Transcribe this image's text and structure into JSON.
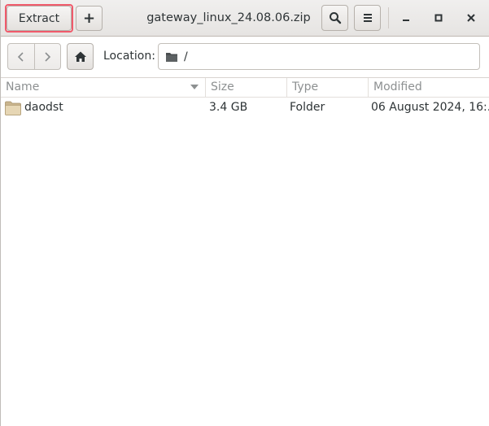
{
  "header": {
    "title": "gateway_linux_24.08.06.zip",
    "extract_label": "Extract",
    "add_label": "+",
    "search_icon": "search-icon",
    "menu_icon": "hamburger-menu-icon",
    "window_controls": [
      "minimize-icon",
      "maximize-icon",
      "close-icon"
    ],
    "highlight_color": "#f05a6b"
  },
  "location_bar": {
    "back_icon": "chevron-left-icon",
    "forward_icon": "chevron-right-icon",
    "home_icon": "home-icon",
    "label": "Location:",
    "folder_icon": "folder-icon",
    "path": "/"
  },
  "list": {
    "columns": [
      "Name",
      "Size",
      "Type",
      "Modified"
    ],
    "sorted_by": "Name",
    "rows": [
      {
        "icon": "folder-icon",
        "name": "daodst",
        "size": "3.4 GB",
        "type": "Folder",
        "modified": "06 August 2024, 16:..."
      }
    ]
  }
}
